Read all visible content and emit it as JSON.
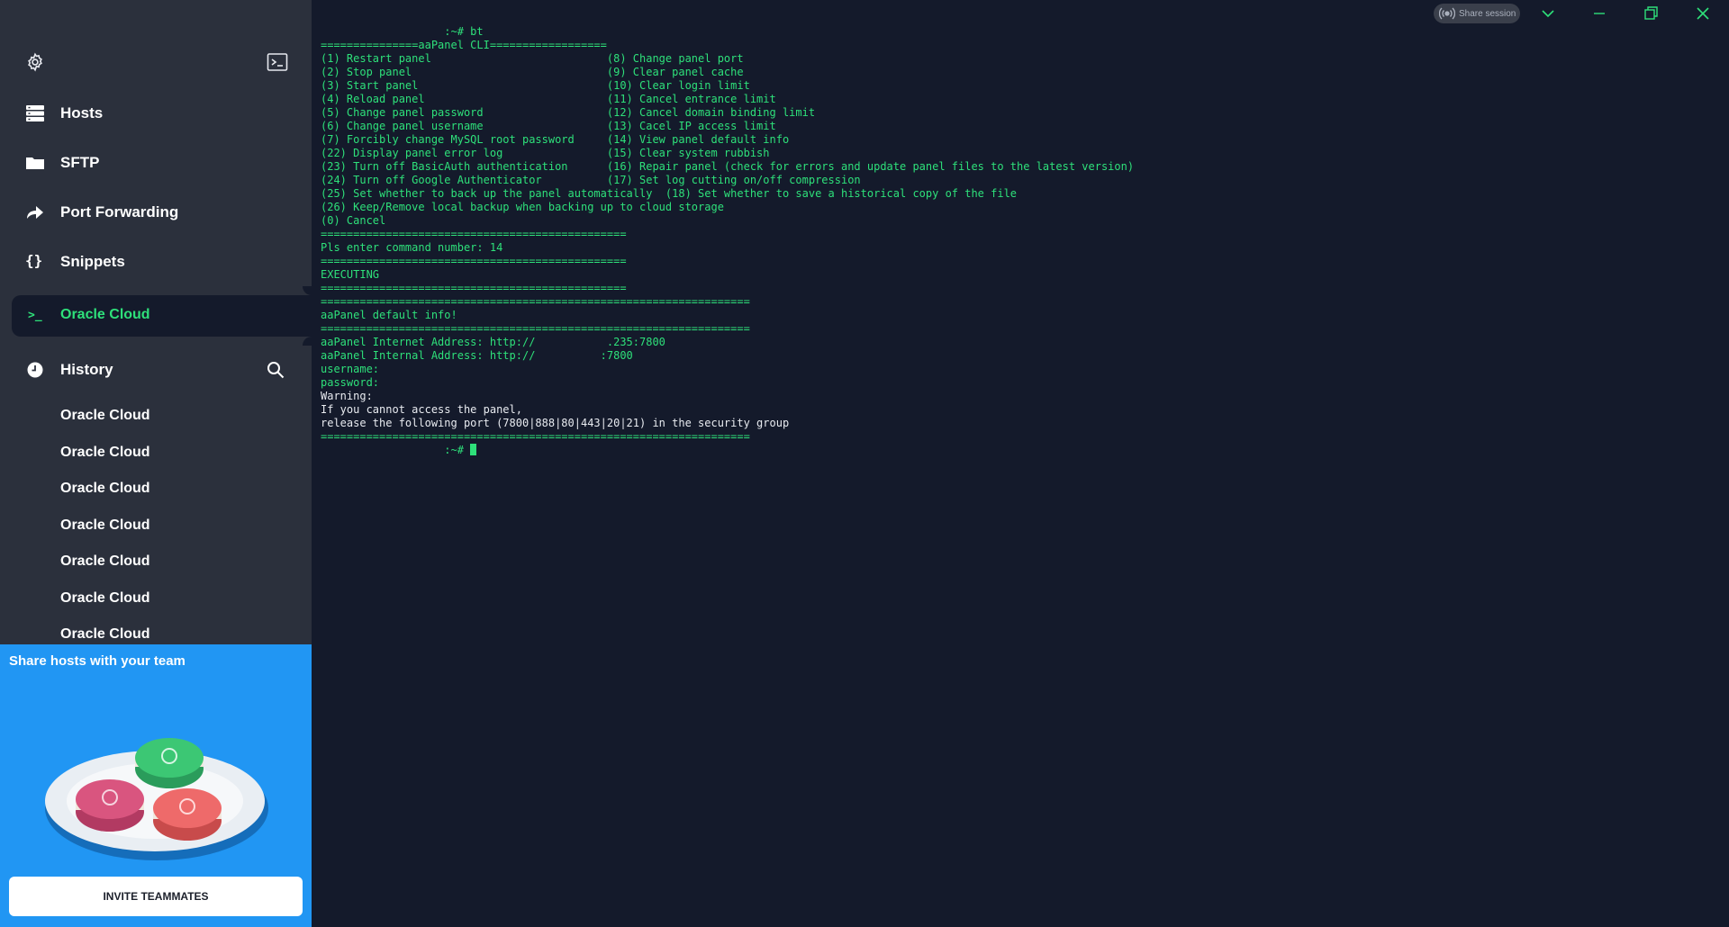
{
  "sidebar": {
    "nav": [
      {
        "label": "Hosts",
        "icon": "hosts-icon"
      },
      {
        "label": "SFTP",
        "icon": "folder-icon"
      },
      {
        "label": "Port Forwarding",
        "icon": "port-forwarding-icon"
      },
      {
        "label": "Snippets",
        "icon": "snippets-icon"
      }
    ],
    "active": {
      "label": "Oracle Cloud",
      "icon_glyph": ">_"
    },
    "history": {
      "label": "History",
      "items": [
        "Oracle Cloud",
        "Oracle Cloud",
        "Oracle Cloud",
        "Oracle Cloud",
        "Oracle Cloud",
        "Oracle Cloud",
        "Oracle Cloud"
      ]
    }
  },
  "promo": {
    "title": "Share hosts with your team",
    "button": "INVITE TEAMMATES"
  },
  "window": {
    "share_session": "Share session"
  },
  "terminal": {
    "lines": [
      {
        "text": "                   :~# bt",
        "color": "green"
      },
      {
        "text": "===============aaPanel CLI==================",
        "color": "green"
      },
      {
        "text": "(1) Restart panel                           (8) Change panel port",
        "color": "green"
      },
      {
        "text": "(2) Stop panel                              (9) Clear panel cache",
        "color": "green"
      },
      {
        "text": "(3) Start panel                             (10) Clear login limit",
        "color": "green"
      },
      {
        "text": "(4) Reload panel                            (11) Cancel entrance limit",
        "color": "green"
      },
      {
        "text": "(5) Change panel password                   (12) Cancel domain binding limit",
        "color": "green"
      },
      {
        "text": "(6) Change panel username                   (13) Cacel IP access limit",
        "color": "green"
      },
      {
        "text": "(7) Forcibly change MySQL root password     (14) View panel default info",
        "color": "green"
      },
      {
        "text": "(22) Display panel error log                (15) Clear system rubbish",
        "color": "green"
      },
      {
        "text": "(23) Turn off BasicAuth authentication      (16) Repair panel (check for errors and update panel files to the latest version)",
        "color": "green"
      },
      {
        "text": "(24) Turn off Google Authenticator          (17) Set log cutting on/off compression",
        "color": "green"
      },
      {
        "text": "(25) Set whether to back up the panel automatically  (18) Set whether to save a historical copy of the file",
        "color": "green"
      },
      {
        "text": "(26) Keep/Remove local backup when backing up to cloud storage",
        "color": "green"
      },
      {
        "text": "(0) Cancel",
        "color": "green"
      },
      {
        "text": "===============================================",
        "color": "green"
      },
      {
        "text": "Pls enter command number: 14",
        "color": "green"
      },
      {
        "text": "===============================================",
        "color": "green"
      },
      {
        "text": "EXECUTING",
        "color": "green"
      },
      {
        "text": "===============================================",
        "color": "green"
      },
      {
        "text": "==================================================================",
        "color": "green"
      },
      {
        "text": "aaPanel default info!",
        "color": "green"
      },
      {
        "text": "==================================================================",
        "color": "green"
      },
      {
        "text": "aaPanel Internet Address: http://           .235:7800",
        "color": "green"
      },
      {
        "text": "aaPanel Internal Address: http://          :7800",
        "color": "green"
      },
      {
        "text": "username:",
        "color": "green"
      },
      {
        "text": "password:",
        "color": "green"
      },
      {
        "text": "Warning:",
        "color": "white"
      },
      {
        "text": "If you cannot access the panel,",
        "color": "white"
      },
      {
        "text": "release the following port (7800|888|80|443|20|21) in the security group",
        "color": "white"
      },
      {
        "text": "==================================================================",
        "color": "green"
      },
      {
        "text": "                   :~# ",
        "color": "green",
        "cursor": true
      }
    ]
  },
  "colors": {
    "sidebar_bg": "#2b303c",
    "terminal_bg": "#141a2b",
    "accent_green": "#2ee07a",
    "promo_blue": "#2196f3"
  }
}
